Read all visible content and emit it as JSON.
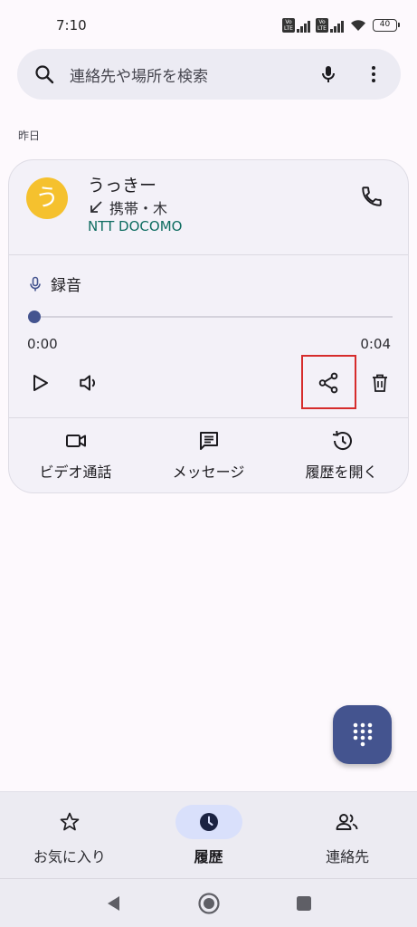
{
  "status_bar": {
    "time": "7:10",
    "lte1": "Vo LTE",
    "lte2": "Vo LTE",
    "battery": "40"
  },
  "search": {
    "placeholder": "連絡先や場所を検索",
    "icon": "search-icon",
    "mic_icon": "mic-icon",
    "more_icon": "more-vert-icon"
  },
  "section": {
    "label": "昨日"
  },
  "call_entry": {
    "avatar_letter": "う",
    "avatar_color": "#f5c12e",
    "name": "うっきー",
    "call_meta": "携帯・木",
    "carrier": "NTT DOCOMO",
    "recording": {
      "label": "録音",
      "time_start": "0:00",
      "time_end": "0:04",
      "progress": 0
    },
    "actions": [
      {
        "icon": "videocam-icon",
        "label": "ビデオ通話"
      },
      {
        "icon": "message-icon",
        "label": "メッセージ"
      },
      {
        "icon": "history-icon",
        "label": "履歴を開く"
      }
    ]
  },
  "bottom_nav": {
    "items": [
      {
        "icon": "star-icon",
        "label": "お気に入り",
        "active": false
      },
      {
        "icon": "clock-icon",
        "label": "履歴",
        "active": true
      },
      {
        "icon": "contacts-icon",
        "label": "連絡先",
        "active": false
      }
    ]
  },
  "colors": {
    "accent": "#44548f",
    "carrier_text": "#0f6d61",
    "highlight": "#d62c2c",
    "nav_pill": "#d9e0fb"
  }
}
